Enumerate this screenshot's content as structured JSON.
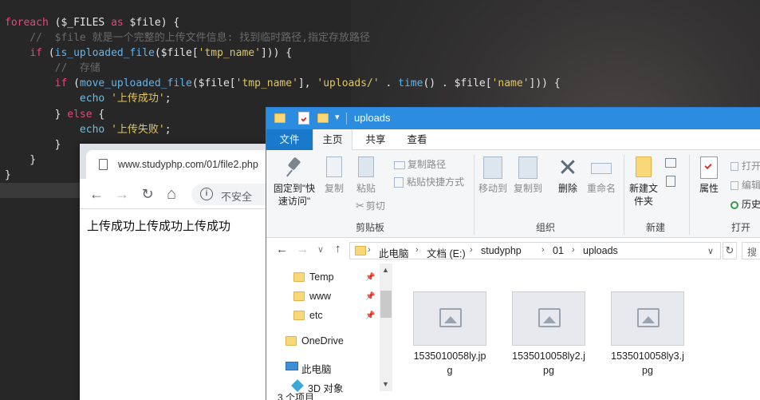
{
  "editor": {
    "lines": [
      [
        {
          "t": "foreach",
          "c": "kw"
        },
        {
          "t": " ($_FILES ",
          "c": "pl"
        },
        {
          "t": "as",
          "c": "kw"
        },
        {
          "t": " $file) {",
          "c": "pl"
        }
      ],
      [
        {
          "t": "    //  $file 就是一个完整的上传文件信息: 找到临时路径,指定存放路径",
          "c": "cmt"
        }
      ],
      [
        {
          "t": "    ",
          "c": "pl"
        },
        {
          "t": "if",
          "c": "kw"
        },
        {
          "t": " (",
          "c": "pl"
        },
        {
          "t": "is_uploaded_file",
          "c": "fn"
        },
        {
          "t": "($file[",
          "c": "pl"
        },
        {
          "t": "'tmp_name'",
          "c": "str"
        },
        {
          "t": "])) {",
          "c": "pl"
        }
      ],
      [
        {
          "t": "        //  存储",
          "c": "cmt"
        }
      ],
      [
        {
          "t": "        ",
          "c": "pl"
        },
        {
          "t": "if",
          "c": "kw"
        },
        {
          "t": " (",
          "c": "pl"
        },
        {
          "t": "move_uploaded_file",
          "c": "fn"
        },
        {
          "t": "($file[",
          "c": "pl"
        },
        {
          "t": "'tmp_name'",
          "c": "str"
        },
        {
          "t": "], ",
          "c": "pl"
        },
        {
          "t": "'uploads/'",
          "c": "str"
        },
        {
          "t": " . ",
          "c": "pl"
        },
        {
          "t": "time",
          "c": "fn"
        },
        {
          "t": "() . $file[",
          "c": "pl"
        },
        {
          "t": "'name'",
          "c": "str"
        },
        {
          "t": "])) {",
          "c": "pl"
        }
      ],
      [
        {
          "t": "            ",
          "c": "pl"
        },
        {
          "t": "echo",
          "c": "ec"
        },
        {
          "t": " ",
          "c": "pl"
        },
        {
          "t": "'上传成功'",
          "c": "str"
        },
        {
          "t": ";",
          "c": "pl"
        }
      ],
      [
        {
          "t": "        } ",
          "c": "pl"
        },
        {
          "t": "else",
          "c": "kw"
        },
        {
          "t": " {",
          "c": "pl"
        }
      ],
      [
        {
          "t": "            ",
          "c": "pl"
        },
        {
          "t": "echo",
          "c": "ec"
        },
        {
          "t": " ",
          "c": "pl"
        },
        {
          "t": "'上传失败'",
          "c": "str"
        },
        {
          "t": ";",
          "c": "pl"
        }
      ],
      [
        {
          "t": "        }",
          "c": "pl"
        }
      ],
      [
        {
          "t": "    }",
          "c": "pl"
        }
      ],
      [
        {
          "t": "}",
          "c": "pl"
        }
      ]
    ]
  },
  "browser": {
    "tab_title": "www.studyphp.com/01/file2.php",
    "back": "←",
    "forward": "→",
    "reload": "↻",
    "home": "⌂",
    "info_glyph": "i",
    "security_text": "不安全",
    "page_text": "上传成功上传成功上传成功"
  },
  "explorer": {
    "window_title": "uploads",
    "qa_dropdown": "▾",
    "tabs": {
      "file": "文件",
      "home": "主页",
      "share": "共享",
      "view": "查看"
    },
    "ribbon": {
      "pin": "固定到\"快速访问\"",
      "copy": "复制",
      "paste": "粘贴",
      "copy_path": "复制路径",
      "paste_shortcut": "粘贴快捷方式",
      "cut": "剪切",
      "group_clipboard": "剪贴板",
      "move_to": "移动到",
      "copy_to": "复制到",
      "delete": "删除",
      "rename": "重命名",
      "group_organize": "组织",
      "new_folder": "新建文件夹",
      "group_new": "新建",
      "properties": "属性",
      "open": "打开",
      "edit": "编辑",
      "history": "历史",
      "group_open": "打开"
    },
    "address": {
      "back": "←",
      "forward": "→",
      "recent": "∨",
      "up": "↑",
      "crumbs": [
        "此电脑",
        "文档 (E:)",
        "studyphp",
        "01",
        "uploads"
      ],
      "sep": "›",
      "dropdown": "∨",
      "refresh": "↻",
      "search_placeholder": "搜"
    },
    "nav": [
      {
        "label": "Temp",
        "pinned": true
      },
      {
        "label": "www",
        "pinned": true
      },
      {
        "label": "etc",
        "pinned": true
      },
      {
        "label": "OneDrive"
      },
      {
        "label": "此电脑"
      },
      {
        "label": "3D 对象"
      }
    ],
    "pin_glyph": "📌",
    "files": [
      {
        "name": "1535010058ly.jpg"
      },
      {
        "name": "1535010058ly2.jpg"
      },
      {
        "name": "1535010058ly3.jpg"
      }
    ],
    "status": "3 个项目"
  }
}
